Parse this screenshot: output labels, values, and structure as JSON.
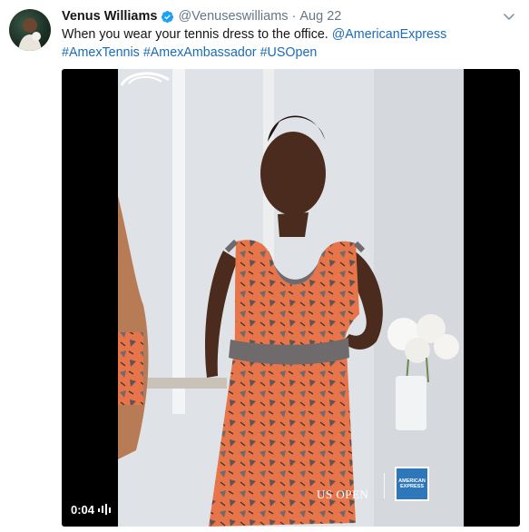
{
  "tweet": {
    "author_name": "Venus Williams",
    "handle": "@Venuseswilliams",
    "separator": "·",
    "timestamp": "Aug 22",
    "text_plain": "When you wear your tennis dress to the office. ",
    "mention": "@AmericanExpress",
    "hashtags": [
      "#AmexTennis",
      "#AmexAmbassador",
      "#USOpen"
    ]
  },
  "video": {
    "elapsed": "0:04",
    "overlay_logo_text": "US OPEN",
    "amex_logo_text": "AMERICAN EXPRESS"
  },
  "colors": {
    "link": "#1b6cb5",
    "secondary_text": "#657786",
    "verified_badge": "#1da1f2",
    "amex_blue": "#2e77bb",
    "dress_orange": "#e8744a",
    "dress_gray": "#6f6a6b"
  },
  "icons": {
    "verified": "verified-badge-icon",
    "caret": "chevron-down-icon",
    "volume": "volume-icon"
  }
}
